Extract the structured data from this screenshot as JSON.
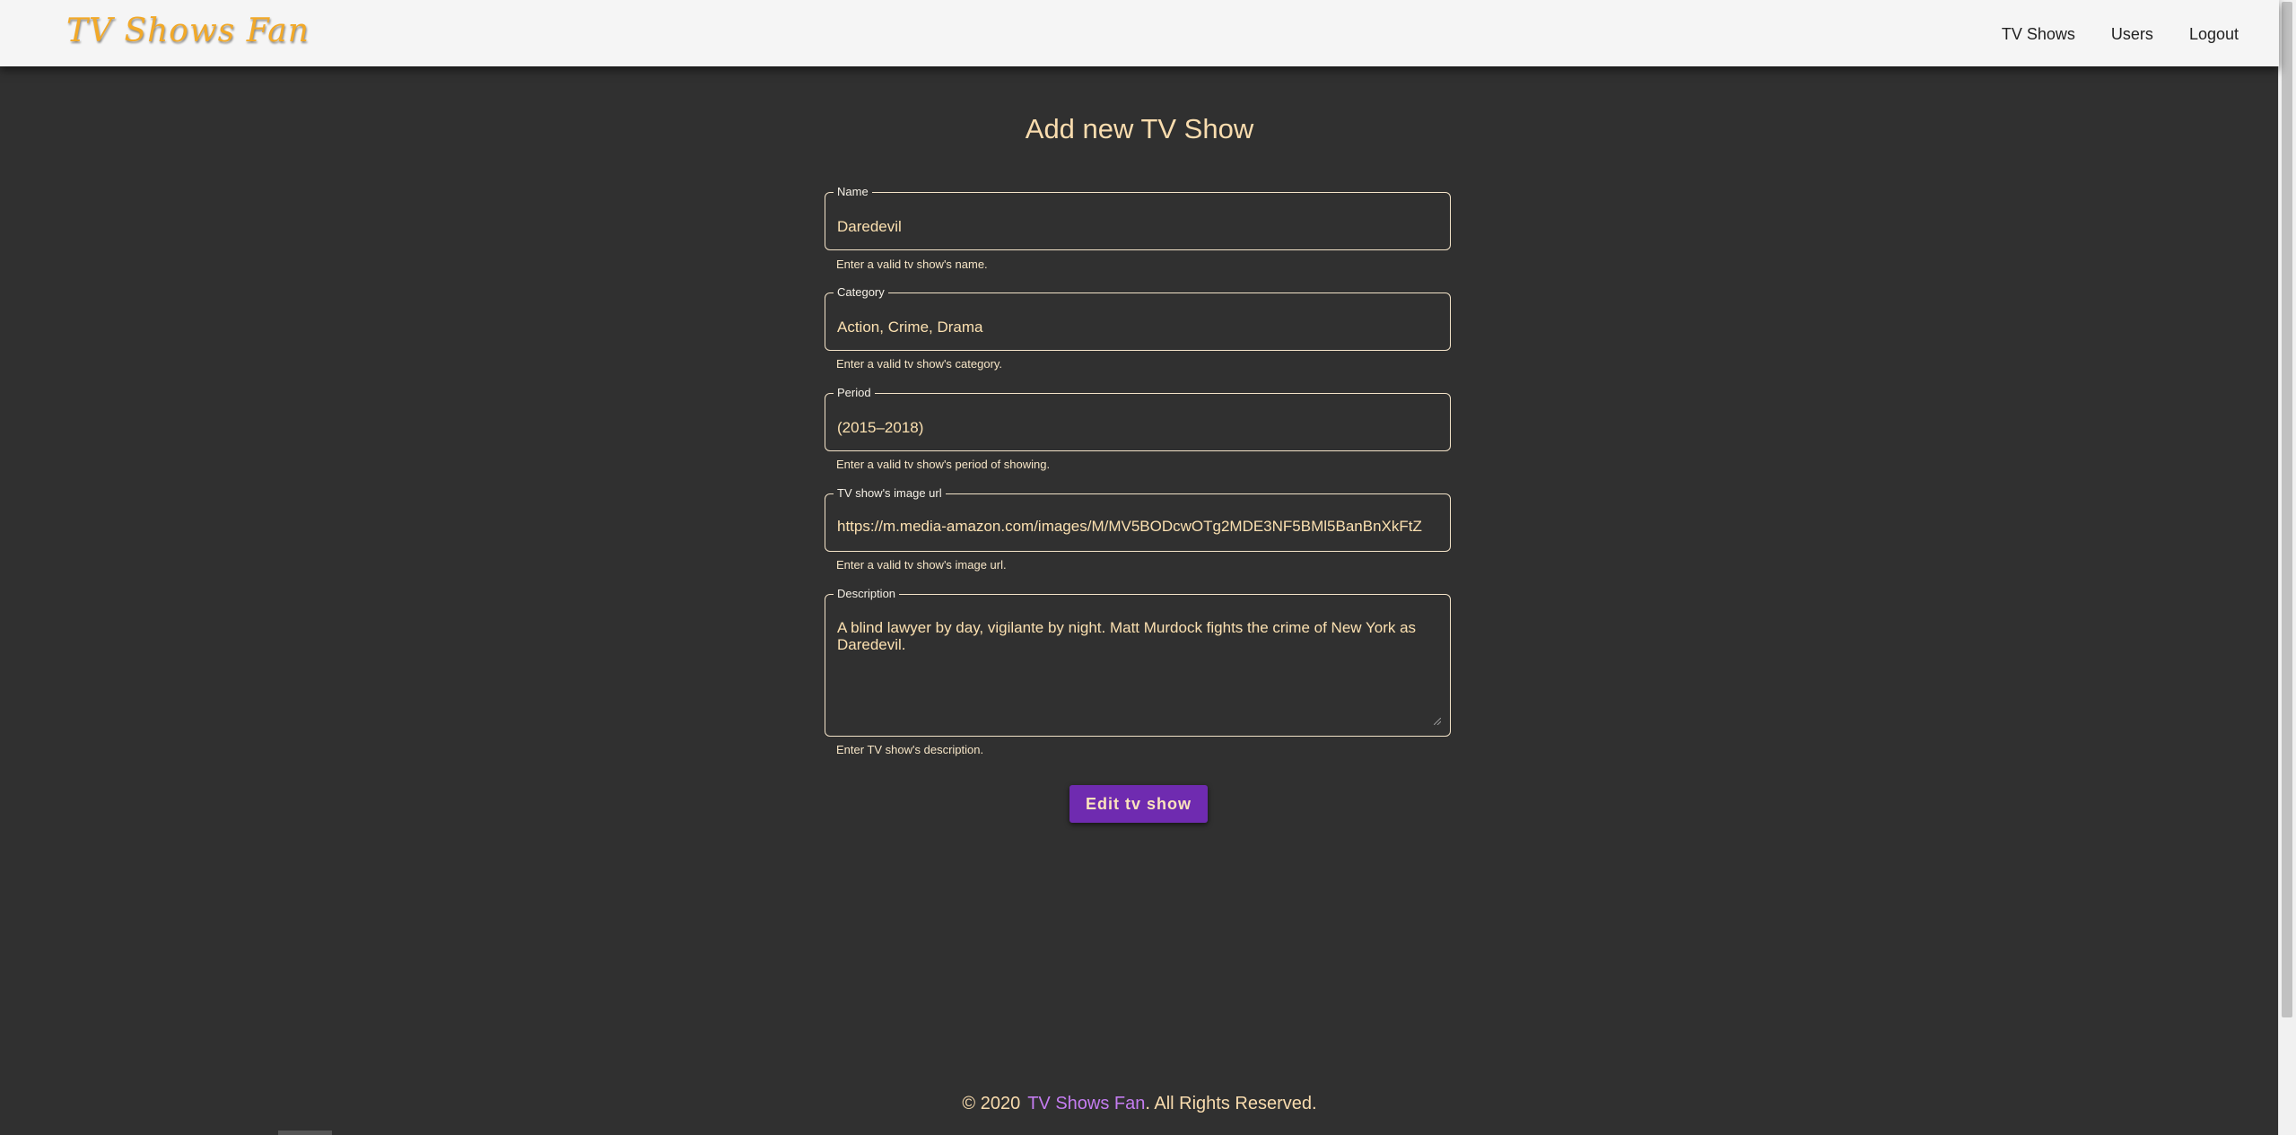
{
  "header": {
    "brand": "TV Shows Fan",
    "nav": [
      {
        "label": "TV Shows"
      },
      {
        "label": "Users"
      },
      {
        "label": "Logout"
      }
    ]
  },
  "form": {
    "title": "Add new TV Show",
    "fields": {
      "name": {
        "label": "Name",
        "value": "Daredevil",
        "hint": "Enter a valid tv show's name."
      },
      "category": {
        "label": "Category",
        "value": "Action, Crime, Drama",
        "hint": "Enter a valid tv show's category."
      },
      "period": {
        "label": "Period",
        "value": "(2015–2018)",
        "hint": "Enter a valid tv show's period of showing."
      },
      "image_url": {
        "label": "TV show's image url",
        "value": "https://m.media-amazon.com/images/M/MV5BODcwOTg2MDE3NF5BMl5BanBnXkFtZ",
        "hint": "Enter a valid tv show's image url."
      },
      "description": {
        "label": "Description",
        "value": "A blind lawyer by day, vigilante by night. Matt Murdock fights the crime of New York as Daredevil.",
        "hint": "Enter TV show's description."
      }
    },
    "submit_label": "Edit tv show"
  },
  "footer": {
    "copyright": "© 2020",
    "brand": "TV Shows Fan",
    "rights": ". All Rights Reserved."
  },
  "colors": {
    "background": "#303030",
    "header_bg": "#f5f5f5",
    "brand": "#f2a928",
    "accent_text": "#f9dcae",
    "button": "#6f2bb0",
    "footer_link": "#c47cf0"
  }
}
